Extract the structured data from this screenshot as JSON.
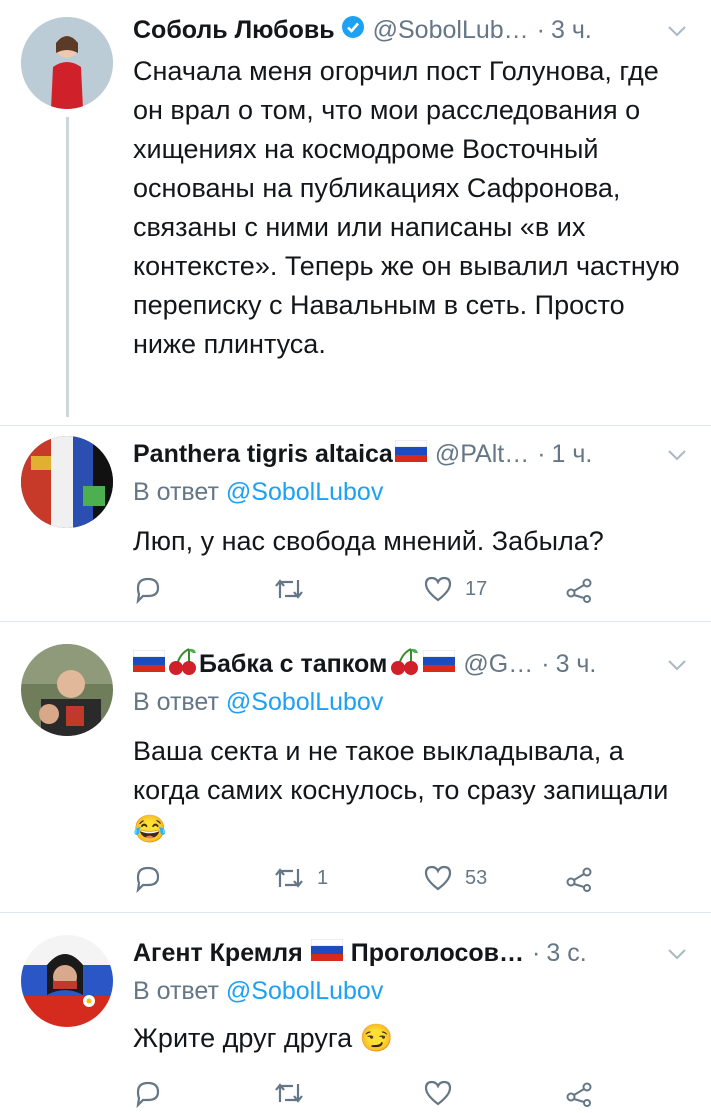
{
  "colors": {
    "link": "#1da1f2",
    "muted": "#657786",
    "text": "#14171a",
    "divider": "#e1e8ed"
  },
  "tweets": [
    {
      "name": "Соболь Любовь",
      "handle": "@SobolLub…",
      "time": "3 ч.",
      "verified": true,
      "text": "Сначала меня огорчил пост Голунова, где он врал о том, что мои расследования о хищениях на космодроме Восточный основаны на публикациях Сафронова, связаны с ними или написаны «в их контексте». Теперь же он вывалил частную переписку с Навальным в сеть. Просто ниже плинтуса."
    },
    {
      "name": "Panthera tigris altaica",
      "handle": "@PAlt…",
      "time": "1 ч.",
      "reply_prefix": "В ответ",
      "reply_to": "@SobolLubov",
      "text": "Люп, у нас свобода мнений. Забыла?",
      "replies": "",
      "retweets": "",
      "likes": "17"
    },
    {
      "name": "Бабка с тапком",
      "handle": "@G…",
      "time": "3 ч.",
      "reply_prefix": "В ответ",
      "reply_to": "@SobolLubov",
      "text": "Ваша секта и не такое выкладывала, а когда самих коснулось, то сразу запищали😂",
      "replies": "",
      "retweets": "1",
      "likes": "53"
    },
    {
      "name": "Агент Кремля",
      "name2": "Проголосов…",
      "time": "3 с.",
      "reply_prefix": "В ответ",
      "reply_to": "@SobolLubov",
      "text": "Жрите друг друга 😏"
    }
  ],
  "icons": {
    "reply": "reply-icon",
    "retweet": "retweet-icon",
    "like": "heart-icon",
    "share": "share-icon",
    "chevron": "chevron-down-icon",
    "verified": "verified-badge-icon"
  },
  "sep": "·"
}
